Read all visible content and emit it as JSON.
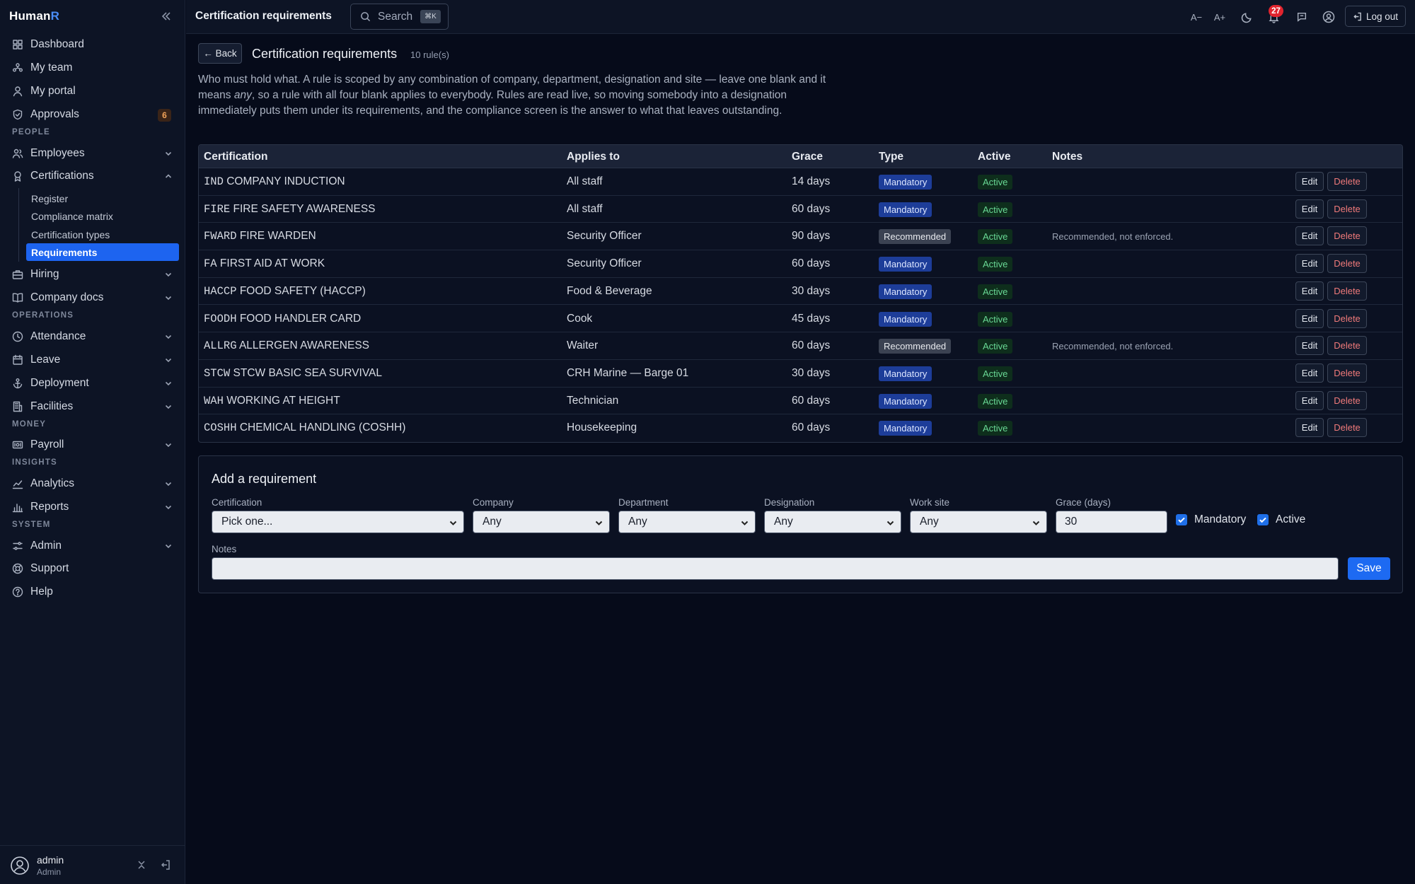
{
  "app": {
    "brand_main": "Human",
    "brand_accent": "R"
  },
  "sidebar": {
    "top_items": [
      {
        "label": "Dashboard",
        "icon": "grid-icon"
      },
      {
        "label": "My team",
        "icon": "team-icon"
      },
      {
        "label": "My portal",
        "icon": "user-icon"
      },
      {
        "label": "Approvals",
        "icon": "shield-check-icon",
        "badge": "6"
      }
    ],
    "sections": {
      "people": "PEOPLE",
      "operations": "OPERATIONS",
      "money": "MONEY",
      "insights": "INSIGHTS",
      "system": "SYSTEM"
    },
    "people_items": [
      {
        "label": "Employees",
        "icon": "users-icon"
      },
      {
        "label": "Certifications",
        "icon": "award-icon"
      }
    ],
    "cert_sub_items": [
      {
        "label": "Register"
      },
      {
        "label": "Compliance matrix"
      },
      {
        "label": "Certification types"
      },
      {
        "label": "Requirements",
        "active": true
      }
    ],
    "people_items_after": [
      {
        "label": "Hiring",
        "icon": "briefcase-icon"
      },
      {
        "label": "Company docs",
        "icon": "book-icon"
      }
    ],
    "operations_items": [
      {
        "label": "Attendance",
        "icon": "clock-icon"
      },
      {
        "label": "Leave",
        "icon": "calendar-icon"
      },
      {
        "label": "Deployment",
        "icon": "anchor-icon"
      },
      {
        "label": "Facilities",
        "icon": "building-icon"
      }
    ],
    "money_items": [
      {
        "label": "Payroll",
        "icon": "payroll-icon"
      }
    ],
    "insights_items": [
      {
        "label": "Analytics",
        "icon": "chart-line-icon"
      },
      {
        "label": "Reports",
        "icon": "bar-chart-icon"
      }
    ],
    "system_items": [
      {
        "label": "Admin",
        "icon": "sliders-icon"
      },
      {
        "label": "Support",
        "icon": "lifebuoy-icon"
      },
      {
        "label": "Help",
        "icon": "help-icon"
      }
    ],
    "user": {
      "name": "admin",
      "role": "Admin"
    }
  },
  "topbar": {
    "title": "Certification requirements",
    "search_label": "Search",
    "search_shortcut": "⌘K",
    "notification_count": "27",
    "logout_label": "Log out",
    "font_decrease": "A−",
    "font_increase": "A+"
  },
  "page": {
    "back_label": "← Back",
    "title": "Certification requirements",
    "rule_count": "10 rule(s)",
    "intro_before": "Who must hold what. A rule is scoped by any combination of company, department, designation and site — leave one blank and it means ",
    "intro_em": "any",
    "intro_after": ", so a rule with all four blank applies to everybody. Rules are read live, so moving somebody into a designation immediately puts them under its requirements, and the compliance screen is the answer to what that leaves outstanding."
  },
  "table": {
    "headers": [
      "Certification",
      "Applies to",
      "Grace",
      "Type",
      "Active",
      "Notes"
    ],
    "rows": [
      {
        "code": "IND",
        "name": "COMPANY INDUCTION",
        "applies_to": "All staff",
        "grace": "14 days",
        "type": "Mandatory",
        "active": "Active",
        "notes": ""
      },
      {
        "code": "FIRE",
        "name": "FIRE SAFETY AWARENESS",
        "applies_to": "All staff",
        "grace": "60 days",
        "type": "Mandatory",
        "active": "Active",
        "notes": ""
      },
      {
        "code": "FWARD",
        "name": "FIRE WARDEN",
        "applies_to": "Security Officer",
        "grace": "90 days",
        "type": "Recommended",
        "active": "Active",
        "notes": "Recommended, not enforced."
      },
      {
        "code": "FA",
        "name": "FIRST AID AT WORK",
        "applies_to": "Security Officer",
        "grace": "60 days",
        "type": "Mandatory",
        "active": "Active",
        "notes": ""
      },
      {
        "code": "HACCP",
        "name": "FOOD SAFETY (HACCP)",
        "applies_to": "Food & Beverage",
        "grace": "30 days",
        "type": "Mandatory",
        "active": "Active",
        "notes": ""
      },
      {
        "code": "FOODH",
        "name": "FOOD HANDLER CARD",
        "applies_to": "Cook",
        "grace": "45 days",
        "type": "Mandatory",
        "active": "Active",
        "notes": ""
      },
      {
        "code": "ALLRG",
        "name": "ALLERGEN AWARENESS",
        "applies_to": "Waiter",
        "grace": "60 days",
        "type": "Recommended",
        "active": "Active",
        "notes": "Recommended, not enforced."
      },
      {
        "code": "STCW",
        "name": "STCW BASIC SEA SURVIVAL",
        "applies_to": "CRH Marine — Barge 01",
        "grace": "30 days",
        "type": "Mandatory",
        "active": "Active",
        "notes": ""
      },
      {
        "code": "WAH",
        "name": "WORKING AT HEIGHT",
        "applies_to": "Technician",
        "grace": "60 days",
        "type": "Mandatory",
        "active": "Active",
        "notes": ""
      },
      {
        "code": "COSHH",
        "name": "CHEMICAL HANDLING (COSHH)",
        "applies_to": "Housekeeping",
        "grace": "60 days",
        "type": "Mandatory",
        "active": "Active",
        "notes": ""
      }
    ],
    "edit_label": "Edit",
    "delete_label": "Delete"
  },
  "form": {
    "title": "Add a requirement",
    "certification_label": "Certification",
    "certification_value": "Pick one...",
    "company_label": "Company",
    "company_value": "Any",
    "department_label": "Department",
    "department_value": "Any",
    "designation_label": "Designation",
    "designation_value": "Any",
    "site_label": "Work site",
    "site_value": "Any",
    "grace_label": "Grace (days)",
    "grace_value": "30",
    "mandatory_label": "Mandatory",
    "mandatory_checked": true,
    "active_label": "Active",
    "active_checked": true,
    "notes_label": "Notes",
    "notes_value": "",
    "save_label": "Save"
  },
  "colors": {
    "accent": "#1d6af2",
    "danger": "#f07a7a",
    "success": "#69d995",
    "warning": "#f2a35a"
  }
}
